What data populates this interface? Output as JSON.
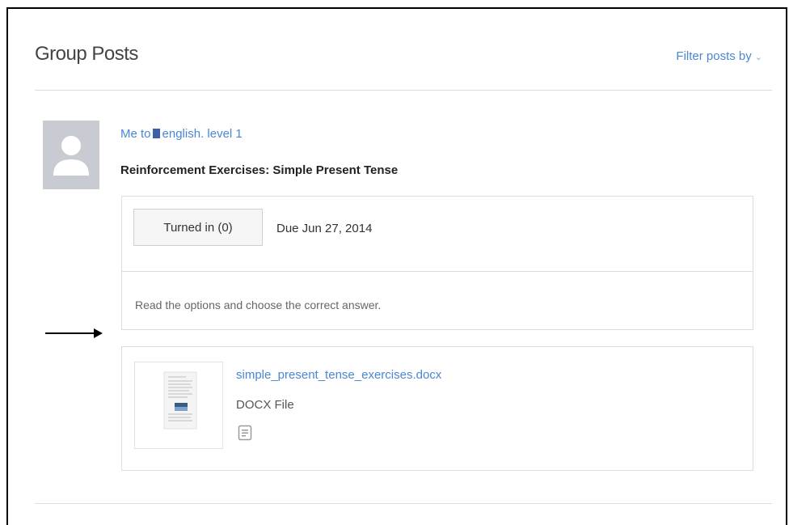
{
  "header": {
    "title": "Group Posts",
    "filter_label": "Filter posts by"
  },
  "post": {
    "sender": "Me",
    "connector": "to",
    "group_name": "english. level 1",
    "title": "Reinforcement Exercises: Simple Present Tense",
    "assignment": {
      "turned_in_label": "Turned in (0)",
      "due_label": "Due Jun 27, 2014",
      "instructions": "Read the options and choose the correct answer."
    },
    "attachment": {
      "file_name": "simple_present_tense_exercises.docx",
      "file_type": "DOCX File"
    }
  },
  "icons": {
    "avatar": "user-silhouette-icon",
    "group": "group-square-icon",
    "filter_chevron": "chevron-down-icon",
    "attachment_doc": "document-icon",
    "annotation": "arrow-right-icon"
  },
  "colors": {
    "link": "#4a86d4",
    "group_square": "#3b5fa8",
    "avatar_bg": "#c8ccd2",
    "border": "#dcdcdc"
  }
}
